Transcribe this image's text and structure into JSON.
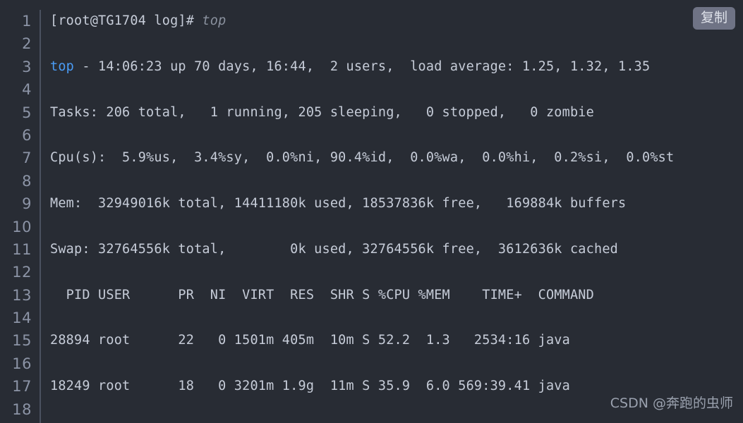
{
  "window": {
    "background_color": "#282c34",
    "text_color": "#c6ccd8",
    "gutter_color": "#8c94a6",
    "keyword_color": "#4a9cf6",
    "comment_color": "#8a919e"
  },
  "copy_button": {
    "label": "复制",
    "background_color": "#6f7385"
  },
  "watermark": {
    "text": "CSDN @奔跑的虫师"
  },
  "editor": {
    "line_numbers": [
      "1",
      "2",
      "3",
      "4",
      "5",
      "6",
      "7",
      "8",
      "9",
      "10",
      "11",
      "12",
      "13",
      "14",
      "15",
      "16",
      "17",
      "18"
    ],
    "lines": [
      {
        "number": "1",
        "text": "[root@TG1704 log]# top",
        "tokens": [
          {
            "type": "plain",
            "text": "[root@TG1704 log]# "
          },
          {
            "type": "comment",
            "text": "top"
          }
        ]
      },
      {
        "number": "2",
        "text": "",
        "tokens": []
      },
      {
        "number": "3",
        "text": "top - 14:06:23 up 70 days, 16:44,  2 users,  load average: 1.25, 1.32, 1.35",
        "tokens": [
          {
            "type": "keyword",
            "text": "top"
          },
          {
            "type": "plain",
            "text": " - 14:06:23 up 70 days, 16:44,  2 users,  load average: 1.25, 1.32, 1.35"
          }
        ]
      },
      {
        "number": "4",
        "text": "",
        "tokens": []
      },
      {
        "number": "5",
        "text": "Tasks: 206 total,   1 running, 205 sleeping,   0 stopped,   0 zombie",
        "tokens": [
          {
            "type": "plain",
            "text": "Tasks: 206 total,   1 running, 205 sleeping,   0 stopped,   0 zombie"
          }
        ]
      },
      {
        "number": "6",
        "text": "",
        "tokens": []
      },
      {
        "number": "7",
        "text": "Cpu(s):  5.9%us,  3.4%sy,  0.0%ni, 90.4%id,  0.0%wa,  0.0%hi,  0.2%si,  0.0%st",
        "tokens": [
          {
            "type": "plain",
            "text": "Cpu(s):  5.9%us,  3.4%sy,  0.0%ni, 90.4%id,  0.0%wa,  0.0%hi,  0.2%si,  0.0%st"
          }
        ]
      },
      {
        "number": "8",
        "text": "",
        "tokens": []
      },
      {
        "number": "9",
        "text": "Mem:  32949016k total, 14411180k used, 18537836k free,   169884k buffers",
        "tokens": [
          {
            "type": "plain",
            "text": "Mem:  32949016k total, 14411180k used, 18537836k free,   169884k buffers"
          }
        ]
      },
      {
        "number": "10",
        "text": "",
        "tokens": []
      },
      {
        "number": "11",
        "text": "Swap: 32764556k total,        0k used, 32764556k free,  3612636k cached",
        "tokens": [
          {
            "type": "plain",
            "text": "Swap: 32764556k total,        0k used, 32764556k free,  3612636k cached"
          }
        ]
      },
      {
        "number": "12",
        "text": "",
        "tokens": []
      },
      {
        "number": "13",
        "text": "  PID USER      PR  NI  VIRT  RES  SHR S %CPU %MEM    TIME+  COMMAND",
        "tokens": [
          {
            "type": "plain",
            "text": "  PID USER      PR  NI  VIRT  RES  SHR S %CPU %MEM    TIME+  COMMAND"
          }
        ]
      },
      {
        "number": "14",
        "text": "",
        "tokens": []
      },
      {
        "number": "15",
        "text": "28894 root      22   0 1501m 405m  10m S 52.2  1.3   2534:16 java",
        "tokens": [
          {
            "type": "plain",
            "text": "28894 root      22   0 1501m 405m  10m S 52.2  1.3   2534:16 java"
          }
        ]
      },
      {
        "number": "16",
        "text": "",
        "tokens": []
      },
      {
        "number": "17",
        "text": "18249 root      18   0 3201m 1.9g  11m S 35.9  6.0 569:39.41 java",
        "tokens": [
          {
            "type": "plain",
            "text": "18249 root      18   0 3201m 1.9g  11m S 35.9  6.0 569:39.41 java"
          }
        ]
      },
      {
        "number": "18",
        "text": "",
        "tokens": []
      }
    ]
  }
}
